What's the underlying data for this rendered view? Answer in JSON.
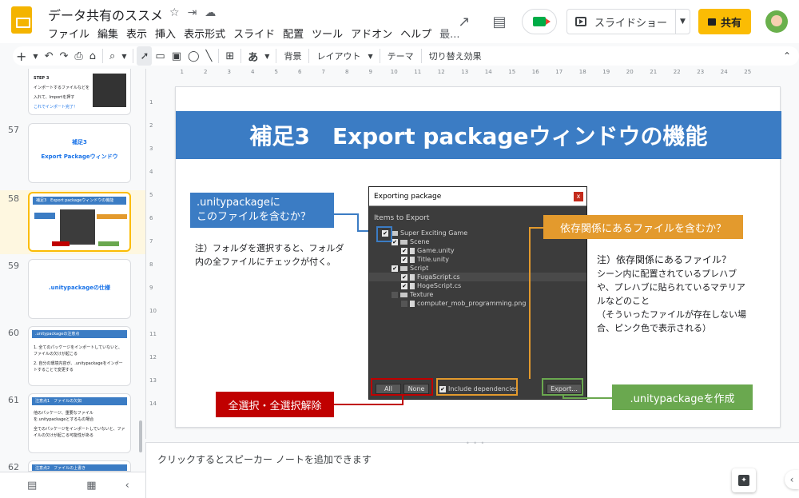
{
  "app": {
    "doc_title": "データ共有のススメ",
    "menu": [
      "ファイル",
      "編集",
      "表示",
      "挿入",
      "表示形式",
      "スライド",
      "配置",
      "ツール",
      "アドオン",
      "ヘルプ",
      "最..."
    ],
    "slideshow_label": "スライドショー",
    "share_label": "共有"
  },
  "toolbar": {
    "plus": "+",
    "background_label": "背景",
    "layout_label": "レイアウト",
    "theme_label": "テーマ",
    "transition_label": "切り替え効果",
    "text_style": "あ"
  },
  "filmstrip": {
    "slides": [
      {
        "num": "",
        "heading": "STEP 3",
        "lines": [
          "インポートするファイルなどを",
          "入れて、Importを押す",
          "これでインポート完了！"
        ]
      },
      {
        "num": "57",
        "heading": "補足3",
        "lines": [
          "Export Packageウィンドウ"
        ]
      },
      {
        "num": "58",
        "heading": "補足3　Export packageウィンドウの機能",
        "lines": []
      },
      {
        "num": "59",
        "heading": ".unitypackageの仕様",
        "lines": []
      },
      {
        "num": "60",
        "heading": ".unitypackageの注意点",
        "lines": [
          "1. 全てのパッケージをインポートしていないと、ファイルの欠けが起こる",
          "2. 自分の環境内容が、.unitypackageをインポートすることで変更する"
        ]
      },
      {
        "num": "61",
        "heading": "注意点1　ファイルの欠如",
        "lines": [
          "他のパッケージ、重要なファイルを.unitypackageとするもの場合",
          "全てのパッケージをインポートしていないと、ファイルの欠けが起こる可能性がある"
        ]
      },
      {
        "num": "62",
        "heading": "注意点2　ファイルの上書き",
        "lines": []
      }
    ]
  },
  "ruler": {
    "h": [
      "1",
      "2",
      "3",
      "4",
      "5",
      "6",
      "7",
      "8",
      "9",
      "10",
      "11",
      "12",
      "13",
      "14",
      "15",
      "16",
      "17",
      "18",
      "19",
      "20",
      "21",
      "22",
      "23",
      "24",
      "25"
    ],
    "v": [
      "1",
      "2",
      "3",
      "4",
      "5",
      "6",
      "7",
      "8",
      "9",
      "10",
      "11",
      "12",
      "13",
      "14"
    ]
  },
  "slide": {
    "title": "補足3　Export packageウィンドウの機能",
    "callout_blue": {
      "line1": ".unitypackageに",
      "line2": "このファイルを含むか？",
      "color": "#3b7cc4"
    },
    "note_left": {
      "line1": "注）フォルダを選択すると、フォルダ",
      "line2": "内の全ファイルにチェックが付く。"
    },
    "callout_orange": {
      "text": "依存関係にあるファイルを含むか？",
      "color": "#e39a2d"
    },
    "note_right": {
      "line1": "注）依存関係にあるファイル？",
      "line2": "シーン内に配置されているプレハブ",
      "line3": "や、プレハブに貼られているマテリア",
      "line4": "ルなどのこと",
      "line5": "（そういったファイルが存在しない場",
      "line6": "合、ピンク色で表示される）"
    },
    "callout_red": {
      "text": "全選択・全選択解除",
      "color": "#c00000"
    },
    "callout_green": {
      "text": ".unitypackageを作成",
      "color": "#6aa84f"
    }
  },
  "export_window": {
    "title": "Exporting package",
    "close": "x",
    "heading": "Items to Export",
    "tree": [
      {
        "label": "Super Exciting Game",
        "type": "folder",
        "checked": true
      },
      {
        "label": "Scene",
        "type": "folder",
        "checked": true
      },
      {
        "label": "Game.unity",
        "type": "file",
        "checked": true
      },
      {
        "label": "Title.unity",
        "type": "file",
        "checked": true
      },
      {
        "label": "Script",
        "type": "folder",
        "checked": true
      },
      {
        "label": "FugaScript.cs",
        "type": "file",
        "checked": true
      },
      {
        "label": "HogeScript.cs",
        "type": "file",
        "checked": true
      },
      {
        "label": "Texture",
        "type": "folder",
        "checked": false
      },
      {
        "label": "computer_mob_programming.png",
        "type": "file",
        "checked": false
      }
    ],
    "all_btn": "All",
    "none_btn": "None",
    "include_dependencies": "Include dependencies",
    "export_btn": "Export..."
  },
  "notes": {
    "placeholder": "クリックするとスピーカー ノートを追加できます"
  }
}
